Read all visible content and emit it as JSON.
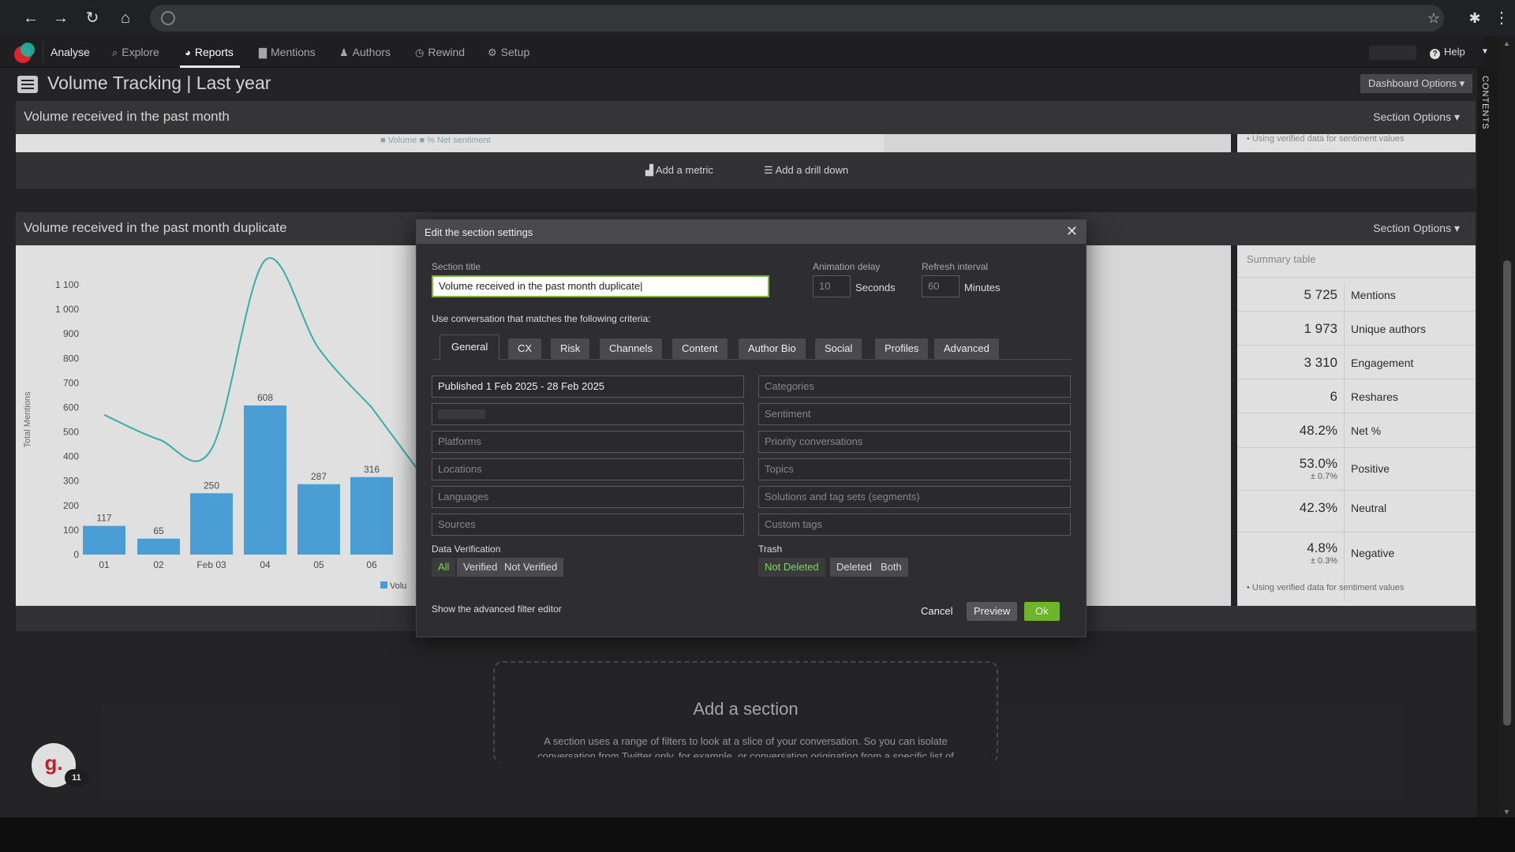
{
  "nav": {
    "items": [
      {
        "label": "Analyse",
        "icon": "none"
      },
      {
        "label": "Explore",
        "icon": "search-icon"
      },
      {
        "label": "Reports",
        "icon": "pie-chart-icon"
      },
      {
        "label": "Mentions",
        "icon": "chat-bubble-icon"
      },
      {
        "label": "Authors",
        "icon": "user-icon"
      },
      {
        "label": "Rewind",
        "icon": "history-icon"
      },
      {
        "label": "Setup",
        "icon": "gear-icon"
      }
    ],
    "help": "Help"
  },
  "contents_label": "CONTENTS",
  "page": {
    "title": "Volume Tracking | Last year",
    "dashboard_options": "Dashboard Options ▾"
  },
  "section1": {
    "title": "Volume received in the past month",
    "options": "Section Options ▾",
    "legend": "■ Volume  ■ % Net sentiment",
    "note": "•  Using verified data for sentiment values",
    "add_metric": "Add a metric",
    "add_drill": "Add a drill down"
  },
  "section2": {
    "title": "Volume received in the past month duplicate",
    "options": "Section Options ▾"
  },
  "chart_data": {
    "type": "bar",
    "categories": [
      "01",
      "02",
      "Feb 03",
      "04",
      "05",
      "06"
    ],
    "series": [
      {
        "name": "Volume",
        "values": [
          117,
          65,
          250,
          608,
          287,
          316
        ]
      },
      {
        "values": [
          570,
          470,
          430,
          1200,
          840,
          600
        ]
      }
    ],
    "ylabel": "Total Mentions",
    "yticks": [
      "0",
      "100",
      "200",
      "300",
      "400",
      "500",
      "600",
      "700",
      "800",
      "900",
      "1 000",
      "1 100"
    ],
    "ylim": [
      0,
      1150
    ],
    "legend_fragment": "Volu",
    "colors": {
      "bar": "#55b3f3",
      "line": "#3fc4c4"
    }
  },
  "summary": {
    "title": "Summary table",
    "rows": [
      {
        "value": "5 725",
        "label": "Mentions",
        "sub": ""
      },
      {
        "value": "1 973",
        "label": "Unique authors",
        "sub": ""
      },
      {
        "value": "3 310",
        "label": "Engagement",
        "sub": ""
      },
      {
        "value": "6",
        "label": "Reshares",
        "sub": ""
      },
      {
        "value": "48.2%",
        "label": "Net %",
        "sub": ""
      },
      {
        "value": "53.0%",
        "label": "Positive",
        "sub": "± 0.7%"
      },
      {
        "value": "42.3%",
        "label": "Neutral",
        "sub": ""
      },
      {
        "value": "4.8%",
        "label": "Negative",
        "sub": "± 0.3%"
      }
    ],
    "note": "•  Using verified data for sentiment values"
  },
  "add_section": {
    "title": "Add a section",
    "desc": "A section uses a range of filters to look at a slice of your conversation. So you can isolate conversation from Twitter only, for example, or conversation originating from a specific list of"
  },
  "chat": {
    "letter": "g.",
    "count": "11"
  },
  "modal": {
    "title": "Edit the section settings",
    "section_title_label": "Section title",
    "section_title_value": "Volume received in the past month duplicate",
    "animation_label": "Animation delay",
    "animation_value": "10",
    "animation_unit": "Seconds",
    "refresh_label": "Refresh interval",
    "refresh_value": "60",
    "refresh_unit": "Minutes",
    "criteria_text": "Use conversation that matches the following criteria:",
    "tabs": [
      "General",
      "CX",
      "Risk",
      "Channels",
      "Content",
      "Author Bio",
      "Social",
      "Profiles",
      "Advanced"
    ],
    "left_fields": [
      "Published 1 Feb 2025 - 28 Feb 2025",
      "",
      "Platforms",
      "Locations",
      "Languages",
      "Sources"
    ],
    "right_fields": [
      "Categories",
      "Sentiment",
      "Priority conversations",
      "Topics",
      "Solutions and tag sets (segments)",
      "Custom tags"
    ],
    "data_verification_label": "Data Verification",
    "data_verification_options": [
      "All",
      "Verified",
      "Not Verified"
    ],
    "trash_label": "Trash",
    "trash_options": [
      "Not Deleted",
      "Deleted",
      "Both"
    ],
    "advanced_link": "Show the advanced filter editor",
    "cancel": "Cancel",
    "preview": "Preview",
    "ok": "Ok",
    "ok_color": "#6fb52c"
  }
}
